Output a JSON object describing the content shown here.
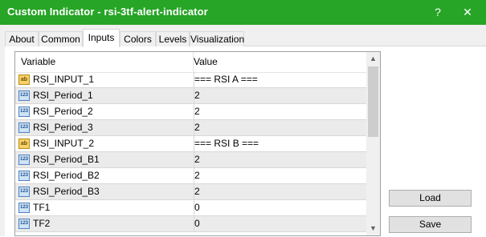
{
  "window": {
    "title": "Custom Indicator - rsi-3tf-alert-indicator",
    "help_glyph": "?",
    "close_glyph": "✕",
    "title_bar_color": "#27a527"
  },
  "tabs": [
    {
      "label": "About",
      "active": false
    },
    {
      "label": "Common",
      "active": false
    },
    {
      "label": "Inputs",
      "active": true
    },
    {
      "label": "Colors",
      "active": false
    },
    {
      "label": "Levels",
      "active": false
    },
    {
      "label": "Visualization",
      "active": false
    }
  ],
  "grid": {
    "headers": {
      "variable": "Variable",
      "value": "Value"
    },
    "rows": [
      {
        "icon": "ab",
        "variable": "RSI_INPUT_1",
        "value": "=== RSI A ==="
      },
      {
        "icon": "123",
        "variable": "RSI_Period_1",
        "value": "2"
      },
      {
        "icon": "123",
        "variable": "RSI_Period_2",
        "value": "2"
      },
      {
        "icon": "123",
        "variable": "RSI_Period_3",
        "value": "2"
      },
      {
        "icon": "ab",
        "variable": "RSI_INPUT_2",
        "value": "=== RSI B ==="
      },
      {
        "icon": "123",
        "variable": "RSI_Period_B1",
        "value": "2"
      },
      {
        "icon": "123",
        "variable": "RSI_Period_B2",
        "value": "2"
      },
      {
        "icon": "123",
        "variable": "RSI_Period_B3",
        "value": "2"
      },
      {
        "icon": "123",
        "variable": "TF1",
        "value": "0"
      },
      {
        "icon": "123",
        "variable": "TF2",
        "value": "0"
      }
    ],
    "icon_labels": {
      "ab": "ab",
      "123": "123"
    }
  },
  "buttons": {
    "load": "Load",
    "save": "Save"
  }
}
